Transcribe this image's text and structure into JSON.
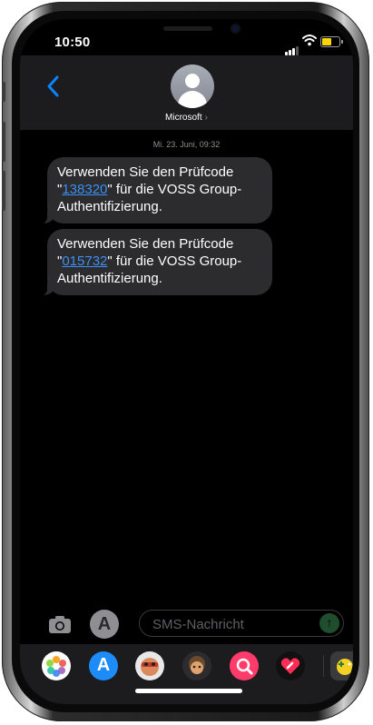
{
  "status_bar": {
    "time": "10:50",
    "battery_level": 0.62,
    "battery_color": "#ffd60a"
  },
  "header": {
    "contact_name": "Microsoft",
    "chevron": "›"
  },
  "messages": {
    "date": "Mi. 23. Juni, 09:32",
    "items": [
      {
        "line1": "Verwenden Sie den Prüfcode",
        "quote_open": "\"",
        "code": "138320",
        "after_code": "\" für die VOSS Group-",
        "line3": "Authentifizierung."
      },
      {
        "line1": "Verwenden Sie den Prüfcode",
        "quote_open": "\"",
        "code": "015732",
        "after_code": "\" für die VOSS Group-",
        "line3": "Authentifizierung."
      }
    ]
  },
  "composer": {
    "placeholder": "SMS-Nachricht",
    "value": ""
  },
  "app_drawer": {
    "icons": [
      "photos-icon",
      "app-store-icon",
      "memoji-stickers-icon",
      "memoji-icon",
      "web-images-icon",
      "digital-touch-icon",
      "game-icon"
    ]
  },
  "colors": {
    "link": "#3b8ff5",
    "bubble": "#2c2c2e",
    "accent_blue": "#0a84ff"
  }
}
